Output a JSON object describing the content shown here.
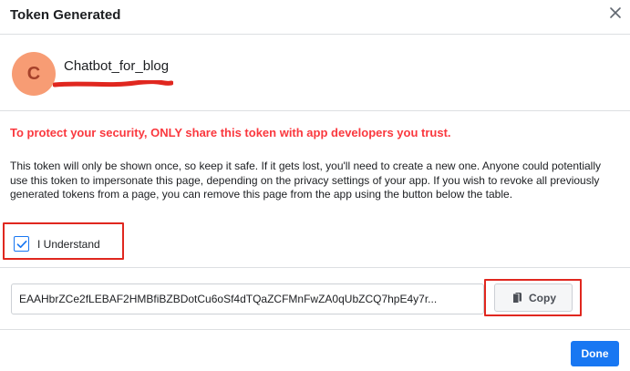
{
  "dialog": {
    "title": "Token Generated",
    "close_icon": "close-icon"
  },
  "page": {
    "avatar_letter": "C",
    "name": "Chatbot_for_blog"
  },
  "warning": "To protect your security, ONLY share this token with app developers you trust.",
  "description": "This token will only be shown once, so keep it safe. If it gets lost, you'll need to create a new one. Anyone could potentially use this token to impersonate this page, depending on the privacy settings of your app. If you wish to revoke all previously generated tokens from a page, you can remove this page from the app using the button below the table.",
  "understand": {
    "label": "I Understand",
    "checked": true
  },
  "token": {
    "value": "EAAHbrZCe2fLEBAF2HMBfiBZBDotCu6oSf4dTQaZCFMnFwZA0qUbZCQ7hpE4y7r..."
  },
  "copy": {
    "label": "Copy",
    "icon": "copy-icon"
  },
  "done": {
    "label": "Done"
  },
  "colors": {
    "accent": "#1877f2",
    "warning": "#fa383e",
    "highlight": "#e0271f",
    "avatar_bg": "#f79c74"
  }
}
